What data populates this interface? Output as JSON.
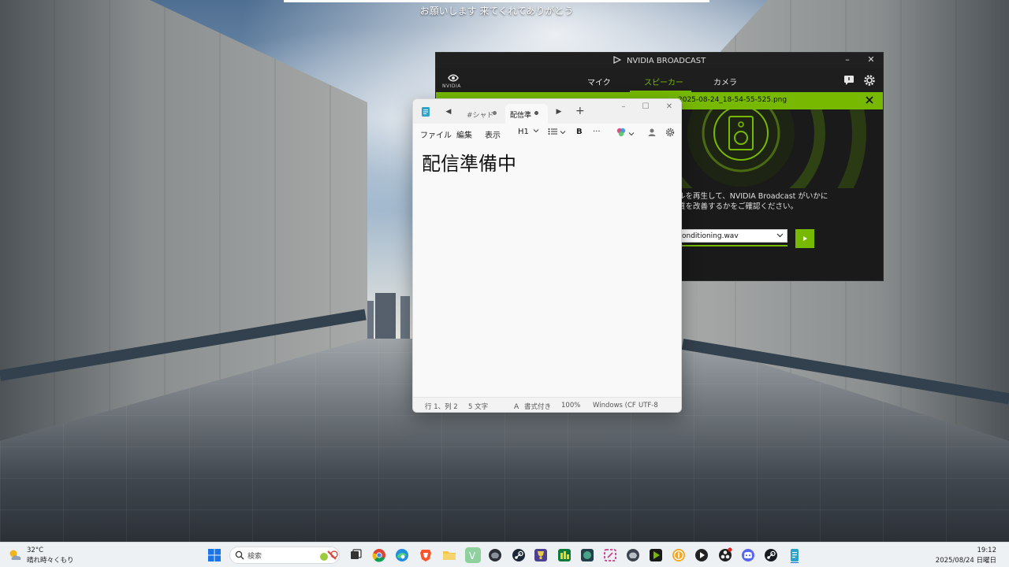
{
  "overlay": {
    "caption": "お願いします 来てくれてありがとう"
  },
  "broadcast": {
    "title": "NVIDIA BROADCAST",
    "brand": "NVIDIA",
    "tabs": [
      {
        "label": "マイク",
        "active": false
      },
      {
        "label": "スピーカー",
        "active": true
      },
      {
        "label": "カメラ",
        "active": false
      }
    ],
    "banner_text": "2025-08-24_18-54-55-525.png",
    "description_line1": "ルを再生して、NVIDIA Broadcast がいかに",
    "description_line2": "質を改善するかをご確認ください。",
    "selected_file": "onditioning.wav",
    "accent": "#76b900"
  },
  "notepad": {
    "tabs": [
      {
        "label": "#シャド",
        "active": false,
        "unsaved": true
      },
      {
        "label": "配信準",
        "active": true,
        "unsaved": true
      }
    ],
    "menu": {
      "file": "ファイル",
      "edit": "編集",
      "view": "表示"
    },
    "heading_tool": "H1",
    "bold_tool": "B",
    "more_tool": "···",
    "content": "配信準備中",
    "status": {
      "position": "行 1、列 2",
      "chars": "5 文字",
      "format": "書式付き",
      "zoom": "100%",
      "line_ending": "Windows (CF",
      "encoding": "UTF-8"
    }
  },
  "taskbar": {
    "weather_temp": "32°C",
    "weather_desc": "晴れ時々くもり",
    "search_placeholder": "検索",
    "time": "19:12",
    "date": "2025/08/24 日曜日",
    "apps": [
      "task-view",
      "chrome",
      "edge",
      "brave",
      "file-explorer",
      "vim-app",
      "helmet-game",
      "steam",
      "trophy-app",
      "green-app",
      "game-app",
      "snip-tool",
      "helmet-game-2",
      "nvidia-app",
      "coin-app",
      "media-player",
      "obs",
      "discord",
      "steam-2",
      "notepad"
    ]
  }
}
